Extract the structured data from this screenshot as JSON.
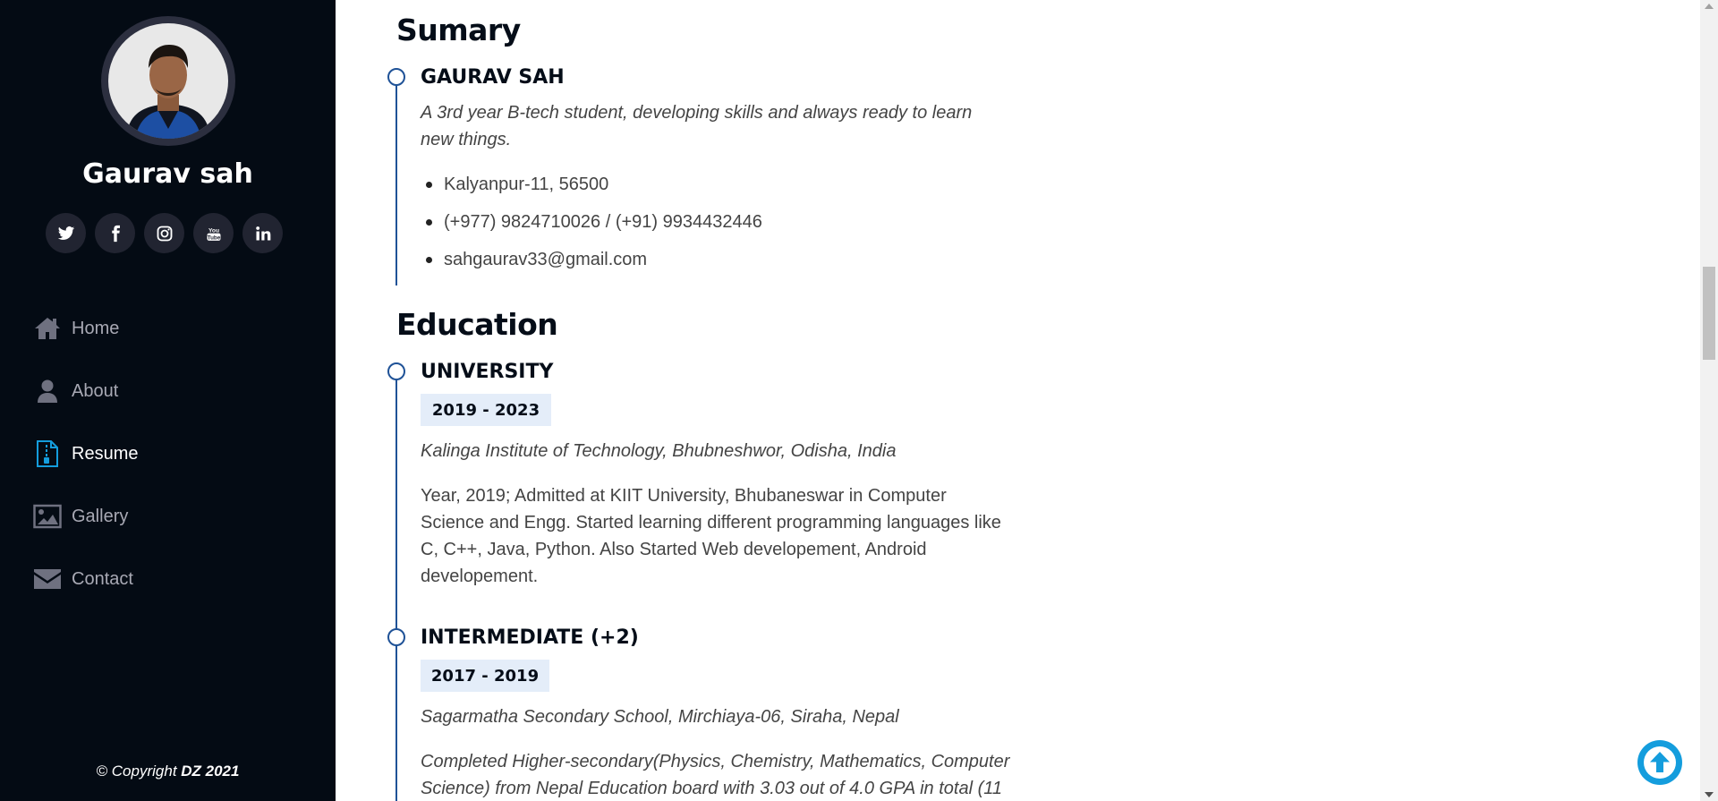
{
  "profile": {
    "name": "Gaurav sah",
    "social": [
      "twitter-icon",
      "facebook-icon",
      "instagram-icon",
      "youtube-icon",
      "linkedin-icon"
    ]
  },
  "nav": {
    "items": [
      {
        "label": "Home",
        "icon": "home-icon"
      },
      {
        "label": "About",
        "icon": "user-icon"
      },
      {
        "label": "Resume",
        "icon": "file-icon",
        "active": true
      },
      {
        "label": "Gallery",
        "icon": "image-icon"
      },
      {
        "label": "Contact",
        "icon": "envelope-icon"
      }
    ]
  },
  "footer": {
    "copyright_prefix": "© Copyright ",
    "copyright_brand": "DZ 2021"
  },
  "summary": {
    "heading": "Sumary",
    "name": "GAURAV SAH",
    "tagline": "A 3rd year B-tech student, developing skills and always ready to learn new things.",
    "contacts": [
      "Kalyanpur-11, 56500",
      "(+977) 9824710026 / (+91) 9934432446",
      "sahgaurav33@gmail.com"
    ]
  },
  "education": {
    "heading": "Education",
    "entries": [
      {
        "title": "UNIVERSITY",
        "years": "2019 - 2023",
        "institution": "Kalinga Institute of Technology, Bhubneshwor, Odisha, India",
        "description": "Year, 2019; Admitted at KIIT University, Bhubaneswar in Computer Science and Engg. Started learning different programming languages like C, C++, Java, Python. Also Started Web developement, Android developement."
      },
      {
        "title": "INTERMEDIATE (+2)",
        "years": "2017 - 2019",
        "institution": "Sagarmatha Secondary School, Mirchiaya-06, Siraha, Nepal",
        "description": "Completed Higher-secondary(Physics, Chemistry, Mathematics, Computer Science) from Nepal Education board with 3.03 out of 4.0 GPA in total (11"
      }
    ]
  },
  "colors": {
    "sidebar_bg": "#040b14",
    "accent": "#149ddd",
    "timeline": "#1f5297",
    "badge_bg": "#e4edf9"
  }
}
